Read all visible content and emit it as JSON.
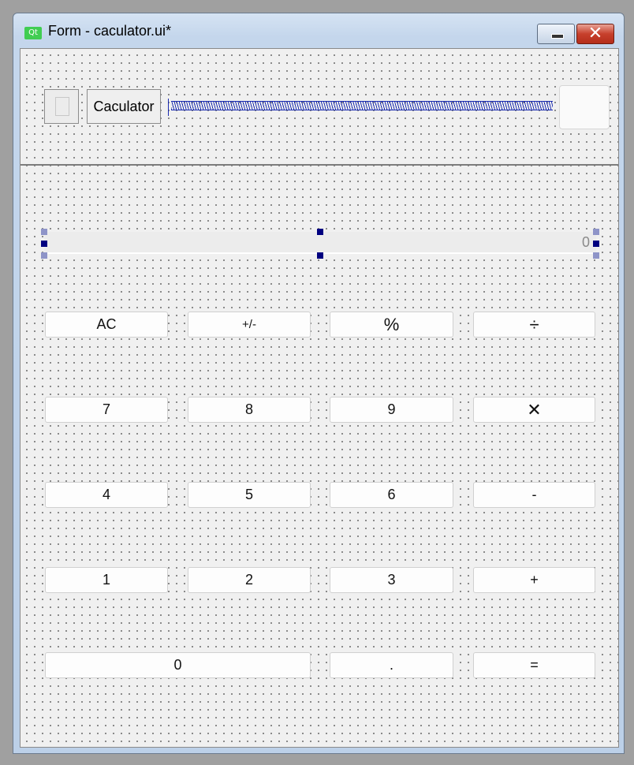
{
  "window": {
    "icon_text": "Qt",
    "title": "Form - caculator.ui*",
    "minimize_glyph": "",
    "close_glyph": "✕"
  },
  "header": {
    "title_label": "Caculator"
  },
  "display": {
    "value": "0"
  },
  "keypad": {
    "ac": "AC",
    "sign": "+/-",
    "percent": "%",
    "divide": "÷",
    "seven": "7",
    "eight": "8",
    "nine": "9",
    "multiply": "✕",
    "four": "4",
    "five": "5",
    "six": "6",
    "minus": "-",
    "one": "1",
    "two": "2",
    "three": "3",
    "plus": "+",
    "zero": "0",
    "dot": ".",
    "equals": "="
  },
  "colors": {
    "qt_green": "#41cd52",
    "selection_handle": "#000080",
    "spacer_blue": "#1a2bb0",
    "close_red": "#c7402c"
  }
}
